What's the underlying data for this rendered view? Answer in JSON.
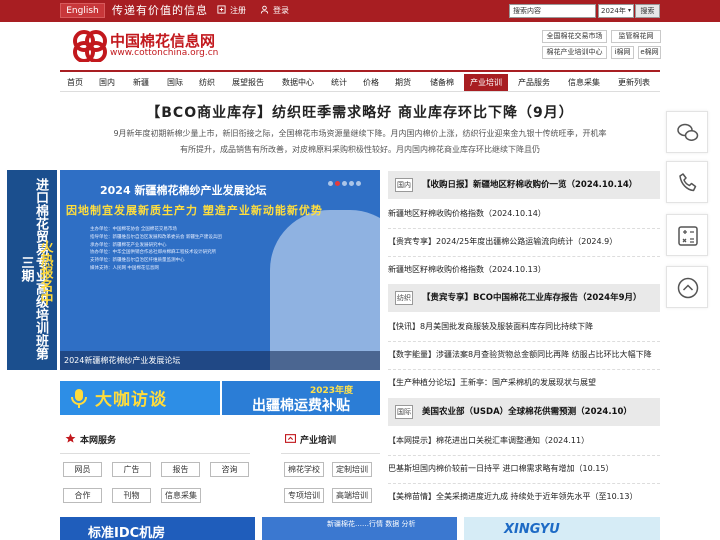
{
  "topbar": {
    "lang_button": "English",
    "slogan": "传递有价值的信息",
    "register": "注册",
    "login": "登录",
    "search_placeholder": "搜索内容",
    "year": "2024年",
    "search_button": "搜索"
  },
  "logo": {
    "name": "中国棉花信息网",
    "url": "www.cottonchina.org.cn"
  },
  "quicklinks": [
    "全国棉花交易市场",
    "监管棉花网",
    "棉花产业培训中心",
    "i棉网",
    "e棉网"
  ],
  "nav": [
    "首页",
    "国内",
    "新疆",
    "国际",
    "纺织",
    "展望报告",
    "数据中心",
    "统计",
    "价格",
    "期货",
    "储备棉",
    "产业培训",
    "产品服务",
    "信息采集",
    "更新列表"
  ],
  "nav_active": "产业培训",
  "headline": "【BCO商业库存】纺织旺季需求略好 商业库存环比下降（9月）",
  "lead": "9月新年度初期新棉少量上市，新旧衔接之际，全国棉花市场资源量继续下降。月内国内棉价上涨，纺织行业迎来金九银十传统旺季，开机率有所提升，成品销售有所改善，对皮棉原料采购积极性较好。月内国内棉花商业库存环比继续下降且仍",
  "side_banner": {
    "title": "进口棉花贸易专业高级培训班第三期",
    "hot": "火热报名中"
  },
  "main_image": {
    "title": "2024 新疆棉花棉纱产业发展论坛",
    "subtitle": "因地制宜发展新质生产力 塑造产业新动能新优势",
    "lines": [
      "主办单位：中国棉花协会 全国棉花交易市场",
      "指导单位：新疆维吾尔自治区发展和改革委员会 新疆生产建设兵团",
      "承办单位：新疆棉花产业发展研究中心",
      "协办单位：中华全国供销合作总社郑州棉麻工程技术设计研究所",
      "支持单位：新疆维吾尔自治区纤维质量监测中心",
      "媒体支持：人民网 中国棉花信息网"
    ],
    "caption": "2024新疆棉花棉纱产业发展论坛"
  },
  "news": {
    "groups": [
      {
        "tag": "国内",
        "title": "【收购日报】新疆地区籽棉收购价一览（2024.10.14）",
        "items": [
          "新疆地区籽棉收购价格指数（2024.10.14）",
          "【贵宾专享】2024/25年度出疆棉公路运输流向统计（2024.9）",
          "新疆地区籽棉收购价格指数（2024.10.13）"
        ]
      },
      {
        "tag": "纺织",
        "title": "【贵宾专享】BCO中国棉花工业库存报告（2024年9月）",
        "items": [
          "【快讯】8月美国批发商服装及服装面料库存同比持续下降",
          "【数字能量】涉疆法案8月查验货物总金额同比再降 纺服占比环比大幅下降",
          "【生产种植分论坛】王新亭：国产采棉机的发展现状与展望"
        ]
      },
      {
        "tag": "国际",
        "title": "美国农业部（USDA）全球棉花供需预测（2024.10）",
        "items": [
          "【本网提示】棉花进出口关税汇率调整通知（2024.11）",
          "巴基斯坦国内棉价较前一日持平 进口棉需求略有增加（10.15）",
          "【美棉苗情】全美采摘进度近九成 持续处于近年领先水平（至10.13）"
        ]
      }
    ]
  },
  "ads": {
    "ad1": "大咖访谈",
    "ad2_year": "2023年度",
    "ad2_title": "出疆棉运费补贴"
  },
  "services": {
    "title": "本网服务",
    "items": [
      "网员",
      "广告",
      "报告",
      "咨询",
      "合作",
      "刊物",
      "信息采集"
    ]
  },
  "training": {
    "title": "产业培训",
    "items": [
      "棉花学校",
      "定制培训",
      "专项培训",
      "高端培训"
    ]
  },
  "bottom_ads": {
    "b1": "标准IDC机房",
    "b2": "新疆棉花……行情 数据 分析",
    "b3": "XINGYU"
  }
}
